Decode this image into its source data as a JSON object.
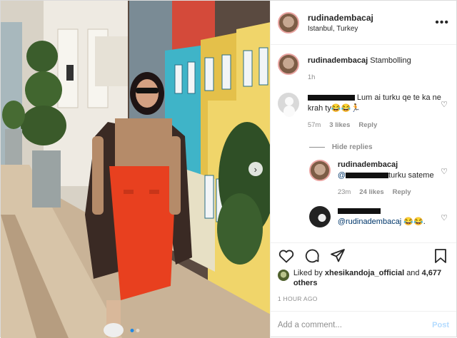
{
  "post": {
    "username": "rudinadembacaj",
    "location": "Istanbul, Turkey",
    "more_label": "•••"
  },
  "caption": {
    "username": "rudinadembacaj",
    "text": "Stambolling",
    "time": "1h"
  },
  "comments": [
    {
      "username_redacted": true,
      "text": "Lum ai turku qe te ka ne krah ty😂😂🏃",
      "time": "57m",
      "likes": "3 likes",
      "reply_label": "Reply"
    }
  ],
  "hide_replies_label": "Hide replies",
  "replies": [
    {
      "username": "rudinadembacaj",
      "mention": "@",
      "text": "turku sateme",
      "time": "23m",
      "likes": "24 likes",
      "reply_label": "Reply"
    },
    {
      "username_redacted": true,
      "mention": "@rudinadembacaj",
      "text": "😂😂.",
      "time": ""
    }
  ],
  "liked_by": {
    "prefix": "Liked by",
    "username": "xhesikandoja_official",
    "and": "and",
    "count": "4,677 others"
  },
  "time_ago": "1 HOUR AGO",
  "add_comment": {
    "placeholder": "Add a comment...",
    "post_label": "Post"
  },
  "carousel": {
    "current": 1,
    "total": 2
  },
  "colors": {
    "accent": "#0095f6",
    "muted": "#8e8e8e",
    "skirt": "#e8401f"
  },
  "icons": [
    "heart-icon",
    "comment-icon",
    "share-icon",
    "bookmark-icon",
    "chevron-right-icon",
    "more-icon"
  ]
}
